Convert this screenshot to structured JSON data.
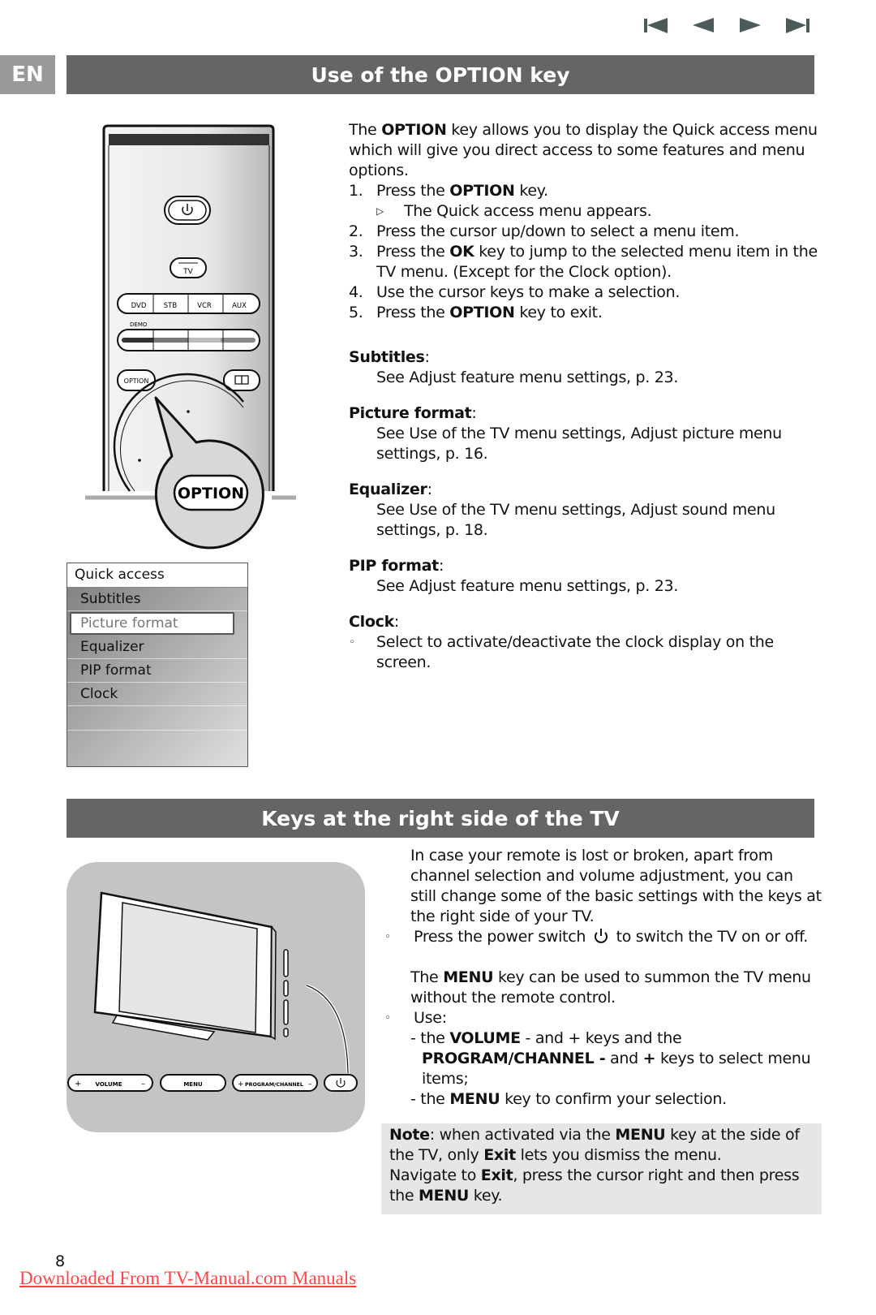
{
  "nav": {
    "buttons": [
      {
        "name": "first-page",
        "icon": "skip-to-start-icon"
      },
      {
        "name": "previous-page",
        "icon": "previous-icon"
      },
      {
        "name": "next-page",
        "icon": "next-icon"
      },
      {
        "name": "last-page",
        "icon": "skip-to-end-icon"
      }
    ]
  },
  "language_tab": "EN",
  "section1": {
    "title": "Use of the OPTION key",
    "intro": {
      "pre": "The ",
      "bold": "OPTION",
      "post": " key allows you to display the Quick access menu which will give you direct access to some features and menu options."
    },
    "steps": [
      {
        "num": "1.",
        "pre": "Press the ",
        "bold": "OPTION",
        "post": " key."
      },
      {
        "num": "2.",
        "pre": "Press the cursor up/down to select a menu item.",
        "bold": "",
        "post": ""
      },
      {
        "num": "3.",
        "pre": "Press the ",
        "bold": "OK",
        "post": " key to jump to the selected menu item in the TV menu. (Except for the Clock option)."
      },
      {
        "num": "4.",
        "pre": "Use the cursor keys to make a selection.",
        "bold": "",
        "post": ""
      },
      {
        "num": "5.",
        "pre": "Press the ",
        "bold": "OPTION",
        "post": " key to exit."
      }
    ],
    "step1_result": "The Quick access menu appears.",
    "features": [
      {
        "name": "Subtitles",
        "desc": "See Adjust feature menu settings, p. 23."
      },
      {
        "name": "Picture format",
        "desc": "See Use of the TV menu settings, Adjust picture menu settings, p. 16."
      },
      {
        "name": "Equalizer",
        "desc": "See Use of the TV menu settings, Adjust sound menu settings, p. 18."
      },
      {
        "name": "PIP format",
        "desc": "See Adjust feature menu settings, p. 23."
      }
    ],
    "clock": {
      "name": "Clock",
      "desc": "Select to activate/deactivate the clock display on the screen."
    },
    "remote": {
      "tv_label": "TV",
      "source_buttons": [
        "DVD",
        "STB",
        "VCR",
        "AUX"
      ],
      "demo_label": "DEMO",
      "option_small": "OPTION",
      "option_callout": "OPTION"
    },
    "quick_access_menu": {
      "title": "Quick access",
      "items": [
        "Subtitles",
        "Picture format",
        "Equalizer",
        "PIP format",
        "Clock"
      ],
      "selected": "Picture format"
    }
  },
  "section2": {
    "title": "Keys at the right side of the TV",
    "intro": "In case your remote is lost or broken, apart from channel selection and volume adjustment, you can still change some of the basic settings with the keys at the right side of your TV.",
    "power_item": {
      "pre": "Press the power switch",
      "post": "to switch the TV on or off."
    },
    "menu_para": {
      "pre": "The ",
      "bold": "MENU",
      "post": " key can be used to summon the TV menu without the remote control."
    },
    "use_label": "Use:",
    "use_line1": {
      "pre": "- the ",
      "bold": "VOLUME",
      "post": " - and + keys and the"
    },
    "use_line2": {
      "bold": "PROGRAM/CHANNEL -",
      "mid": " and ",
      "bold2": "+",
      "post": "  keys to select menu items;"
    },
    "use_line3": {
      "pre": "- the ",
      "bold": "MENU",
      "post": " key to confirm your selection."
    },
    "tv_keys": {
      "volume": "VOLUME",
      "menu": "MENU",
      "program": "PROGRAM/CHANNEL",
      "plus": "+",
      "minus": "–"
    },
    "note": {
      "label": "Note",
      "l1_pre": ": when activated via the ",
      "l1_bold": "MENU",
      "l1_post": " key at the side of the TV, only ",
      "l1_bold2": "Exit",
      "l1_post2": " lets you dismiss the menu.",
      "l2_pre": "Navigate to ",
      "l2_bold": "Exit",
      "l2_post": ", press the cursor right and then press the ",
      "l2_bold2": "MENU",
      "l2_post2": " key."
    }
  },
  "page_number": "8",
  "footer_link": "Downloaded From TV-Manual.com Manuals"
}
